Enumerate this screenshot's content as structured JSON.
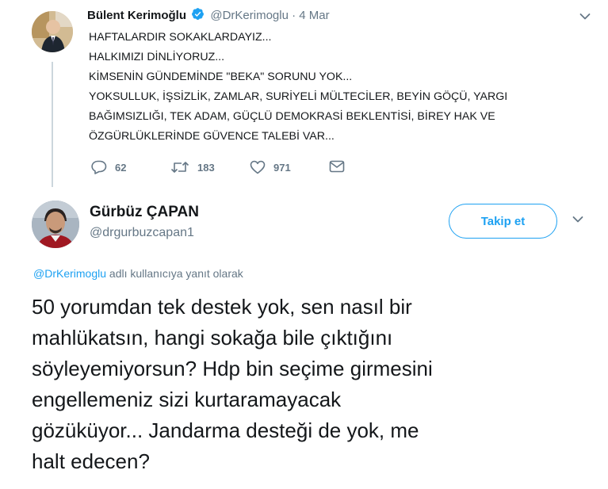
{
  "parent_tweet": {
    "author_name": "Bülent Kerimoğlu",
    "handle": "@DrKerimoglu",
    "dot": "·",
    "date": "4 Mar",
    "text_lines": [
      "HAFTALARDIR SOKAKLARDAYIZ...",
      "HALKIMIZI DİNLİYORUZ...",
      "KİMSENİN GÜNDEMİNDE \"BEKA\" SORUNU YOK...",
      "YOKSULLUK, İŞSİZLİK, ZAMLAR, SURİYELİ MÜLTECİLER, BEYİN GÖÇÜ, YARGI",
      "BAĞIMSIZLIĞI, TEK ADAM, GÜÇLÜ DEMOKRASİ BEKLENTİSİ, BİREY HAK VE",
      "ÖZGÜRLÜKLERİNDE GÜVENCE TALEBİ VAR..."
    ],
    "replies": "62",
    "retweets": "183",
    "likes": "971"
  },
  "main_tweet": {
    "author_name": "Gürbüz ÇAPAN",
    "handle": "@drgurbuzcapan1",
    "follow_label": "Takip et",
    "reply_to_handle": "@DrKerimoglu",
    "reply_to_suffix": " adlı kullanıcıya yanıt olarak",
    "text_lines": [
      "50 yorumdan tek destek yok, sen nasıl bir",
      "mahlükatsın, hangi sokağa bile çıktığını",
      "söyleyemiyorsun? Hdp bin seçime girmesini",
      "engellemeniz sizi kurtaramayacak",
      "gözüküyor... Jandarma desteği de yok, me",
      "halt edecen?"
    ]
  },
  "colors": {
    "accent": "#1da1f2",
    "secondary_text": "#657786",
    "primary_text": "#14171a",
    "thread_line": "#ccd6dd"
  },
  "icons": [
    "verified-badge-icon",
    "chevron-down-icon",
    "reply-icon",
    "retweet-icon",
    "like-icon",
    "direct-message-icon"
  ]
}
